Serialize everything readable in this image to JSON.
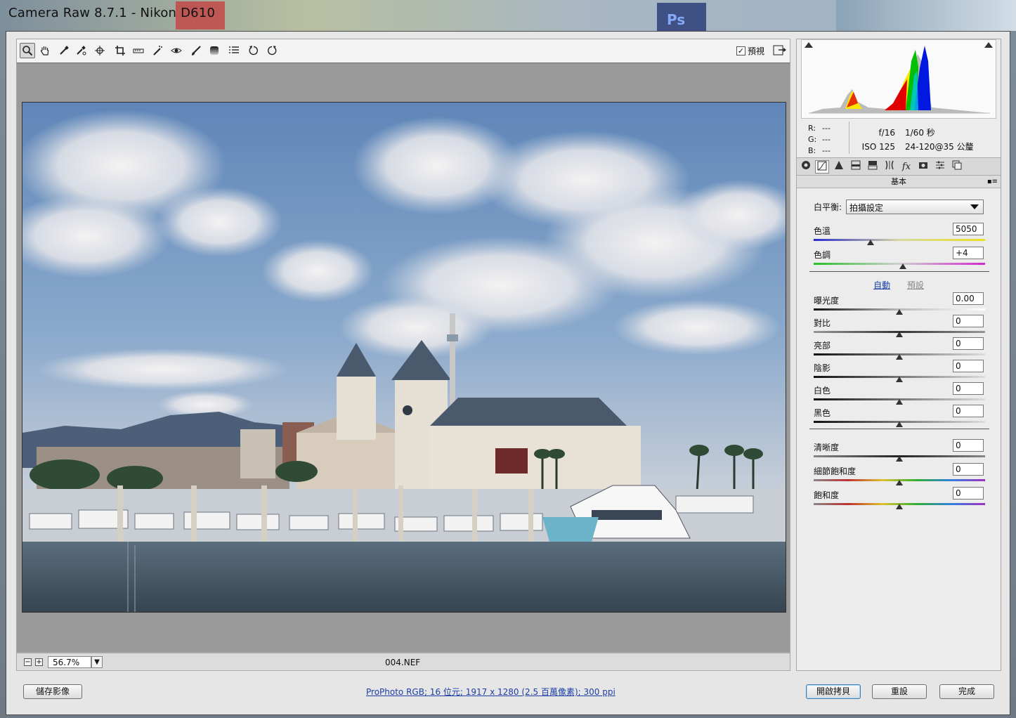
{
  "window": {
    "title": "Camera Raw 8.7.1  -  Nikon D610",
    "taskbar_badge": "Ps"
  },
  "toolbar": {
    "tools": [
      "zoom-tool",
      "hand-tool",
      "white-balance-tool",
      "color-sampler-tool",
      "targeted-adjustment-tool",
      "crop-tool",
      "straighten-tool",
      "spot-removal-tool",
      "red-eye-tool",
      "adjustment-brush-tool",
      "graduated-filter-tool",
      "radial-filter-tool",
      "preferences-tool",
      "rotate-ccw-tool",
      "rotate-cw-tool"
    ],
    "preview_label": "預視",
    "preview_checked": true
  },
  "status": {
    "zoom": "56.7%",
    "filename": "004.NEF"
  },
  "histogram": {
    "r": "---",
    "g": "---",
    "b": "---",
    "r_label": "R:",
    "g_label": "G:",
    "b_label": "B:",
    "aperture": "f/16",
    "shutter": "1/60 秒",
    "iso": "ISO 125",
    "lens": "24-120@35 公釐"
  },
  "panel": {
    "title": "基本",
    "wb_label": "白平衡:",
    "wb_value": "拍攝設定",
    "auto_label": "自動",
    "default_label": "預設",
    "sliders": [
      {
        "label": "色溫",
        "value": "5050",
        "pos": 0.33
      },
      {
        "label": "色調",
        "value": "+4",
        "pos": 0.52
      },
      {
        "label": "曝光度",
        "value": "0.00",
        "pos": 0.5
      },
      {
        "label": "對比",
        "value": "0",
        "pos": 0.5
      },
      {
        "label": "亮部",
        "value": "0",
        "pos": 0.5
      },
      {
        "label": "陰影",
        "value": "0",
        "pos": 0.5
      },
      {
        "label": "白色",
        "value": "0",
        "pos": 0.5
      },
      {
        "label": "黑色",
        "value": "0",
        "pos": 0.5
      },
      {
        "label": "清晰度",
        "value": "0",
        "pos": 0.5
      },
      {
        "label": "細節飽和度",
        "value": "0",
        "pos": 0.5
      },
      {
        "label": "飽和度",
        "value": "0",
        "pos": 0.5
      }
    ]
  },
  "footer": {
    "save_label": "儲存影像",
    "workflow_info": "ProPhoto RGB; 16 位元; 1917 x 1280 (2.5 百萬像素); 300 ppi",
    "open_copy_label": "開啟拷貝",
    "reset_label": "重設",
    "done_label": "完成"
  },
  "colors": {
    "accent_link": "#1d3fa5",
    "default_button_border": "#3c7fb1"
  }
}
